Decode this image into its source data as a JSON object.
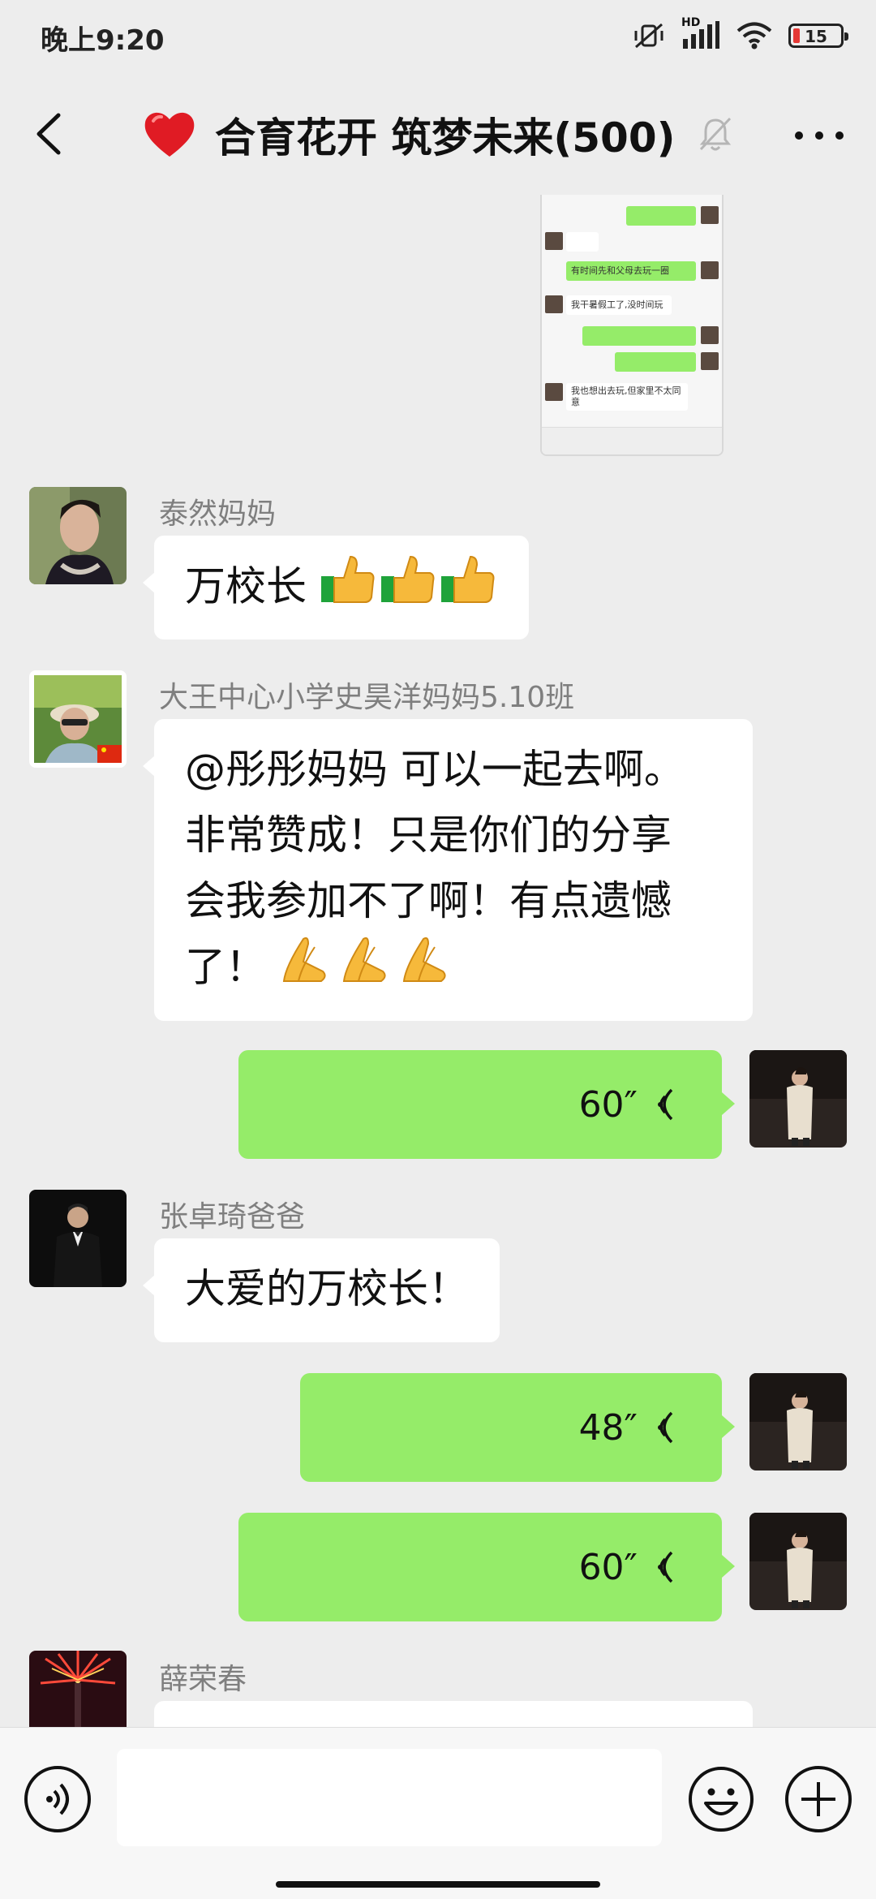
{
  "status": {
    "time": "晚上9:20",
    "network": "HD",
    "battery": "15"
  },
  "header": {
    "title": "合育花开 筑梦未来(500)",
    "icons": [
      "back-icon",
      "heart-icon",
      "mute-icon",
      "more-icon"
    ]
  },
  "shared_screenshot": {
    "lines": [
      "有时间先和父母去玩一圈",
      "我干暑假工了,没时间玩",
      "我也想出去玩,但家里不太同意"
    ]
  },
  "messages": [
    {
      "sender": "泰然妈妈",
      "text": "万校长",
      "emoji": "thumbs-up x3"
    },
    {
      "sender": "大王中心小学史昊洋妈妈5.10班",
      "lines": [
        "@彤彤妈妈  可以一起去啊。",
        "非常赞成！只是你们的分享",
        "会我参加不了啊！有点遗憾",
        "了！"
      ],
      "emoji": "praying-hands x3"
    },
    {
      "type": "voice",
      "duration": "60″"
    },
    {
      "sender": "张卓琦爸爸",
      "text": "大爱的万校长！"
    },
    {
      "type": "voice",
      "duration": "48″"
    },
    {
      "type": "voice",
      "duration": "60″"
    },
    {
      "sender": "薛荣春"
    }
  ],
  "colors": {
    "background": "#ededed",
    "self_bubble": "#95ec69",
    "other_bubble": "#ffffff",
    "heart": "#e01b24"
  }
}
